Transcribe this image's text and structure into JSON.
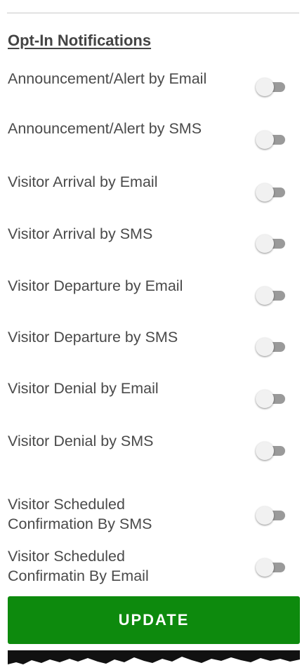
{
  "section": {
    "title": "Opt-In Notifications"
  },
  "notifications": [
    {
      "label": "Announcement/Alert by Email",
      "enabled": false
    },
    {
      "label": "Announcement/Alert by SMS",
      "enabled": false
    },
    {
      "label": "Visitor Arrival by Email",
      "enabled": false
    },
    {
      "label": "Visitor Arrival by SMS",
      "enabled": false
    },
    {
      "label": "Visitor Departure by Email",
      "enabled": false
    },
    {
      "label": "Visitor Departure by SMS",
      "enabled": false
    },
    {
      "label": "Visitor Denial by Email",
      "enabled": false
    },
    {
      "label": "Visitor Denial by SMS",
      "enabled": false
    },
    {
      "label": "Visitor Scheduled Confirmation By SMS",
      "enabled": false
    },
    {
      "label": "Visitor Scheduled Confirmatin By Email",
      "enabled": false
    }
  ],
  "actions": {
    "update_label": "UPDATE"
  },
  "colors": {
    "button": "#0d8a0d",
    "toggle_off_track": "#9a9a9a",
    "toggle_off_thumb": "#f1f1f1",
    "text": "#4a4a4a"
  }
}
